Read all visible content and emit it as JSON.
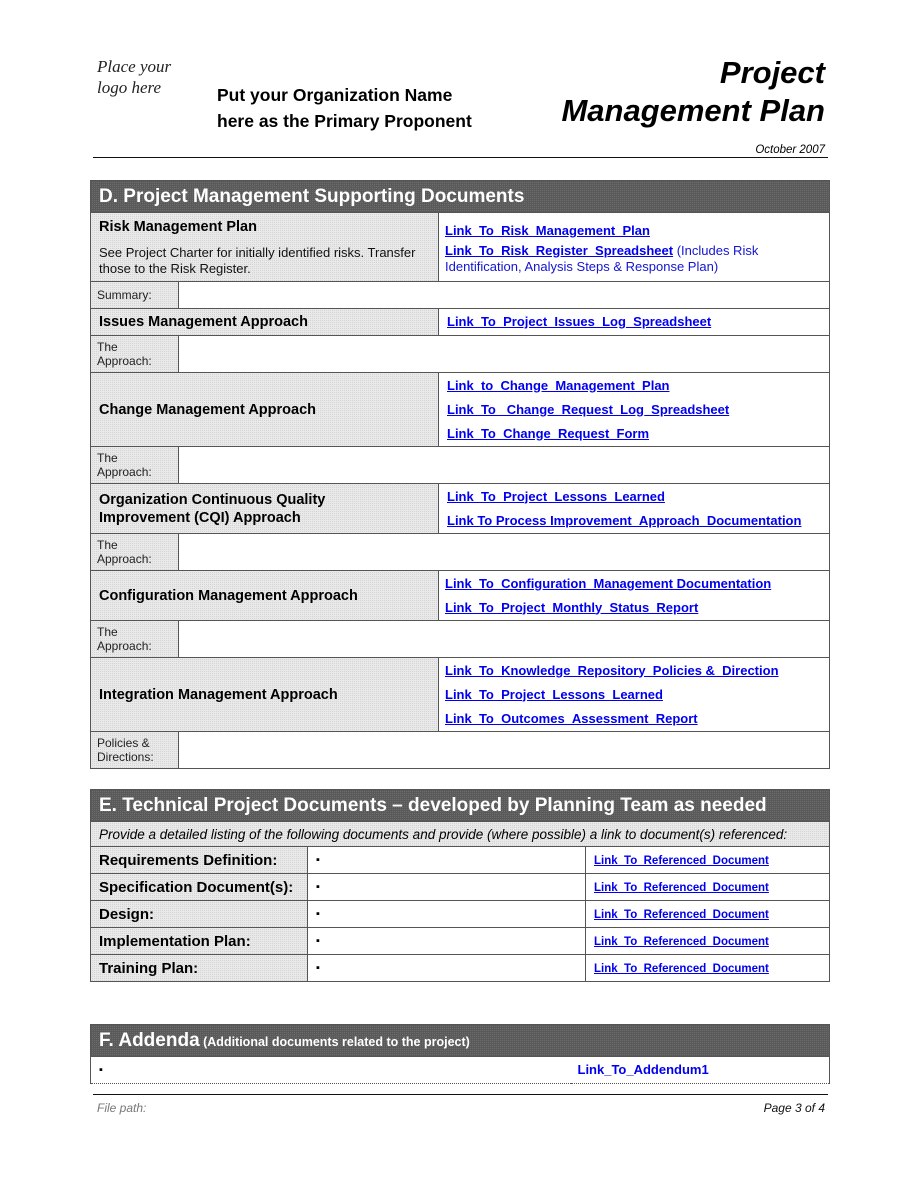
{
  "header": {
    "logo_line1": "Place your",
    "logo_line2": "logo here",
    "org_line1": "Put your Organization Name",
    "org_line2": "here as the Primary Proponent",
    "title_line1": "Project",
    "title_line2": "Management Plan",
    "date": "October 2007"
  },
  "section_d": {
    "title": "D.  Project Management Supporting Documents",
    "risk": {
      "label": "Risk Management Plan",
      "desc": "See Project Charter for initially identified risks. Transfer those to the Risk Register.",
      "link1": "Link_To_Risk_Management_Plan",
      "link2": "Link_To_Risk_Register_Spreadsheet",
      "link2_note": " (Includes Risk Identification, Analysis Steps & Response Plan)",
      "summary_label": "Summary:"
    },
    "issues": {
      "label": "Issues Management Approach",
      "link1": "Link_To_Project_Issues_Log_Spreadsheet",
      "approach_label": "The Approach:"
    },
    "change": {
      "label": "Change Management Approach",
      "link1": "Link_to_Change_Management_Plan",
      "link2": "Link_To_ Change_Request_Log_Spreadsheet",
      "link3": "Link_To_Change_Request_Form",
      "approach_label": "The Approach:"
    },
    "cqi": {
      "label": "Organization Continuous Quality Improvement (CQI) Approach",
      "link1": "Link_To_Project_Lessons_Learned",
      "link2": "Link To Process Improvement_Approach_Documentation",
      "approach_label": "The Approach:"
    },
    "config": {
      "label": "Configuration Management Approach",
      "link1": "Link_To_Configuration_Management Documentation",
      "link2": "Link_To_Project_Monthly_Status_Report",
      "approach_label": "The Approach:"
    },
    "integration": {
      "label": "Integration Management Approach",
      "link1": "Link_To_Knowledge_Repository_Policies &_Direction",
      "link2": "Link_To_Project_Lessons_Learned",
      "link3": "Link_To_Outcomes_Assessment_Report",
      "policies_label": "Policies & Directions:"
    }
  },
  "section_e": {
    "title": "E.  Technical Project Documents – developed by Planning Team as needed",
    "instruction": "Provide a detailed listing of the following documents and provide (where possible) a link to document(s) referenced:",
    "rows": [
      {
        "label": "Requirements Definition:",
        "bullet": "▪",
        "link": "Link_To_Referenced_Document"
      },
      {
        "label": "Specification Document(s):",
        "bullet": "▪",
        "link": "Link_To_Referenced_Document"
      },
      {
        "label": "Design:",
        "bullet": "▪",
        "link": "Link_To_Referenced_Document"
      },
      {
        "label": "Implementation Plan:",
        "bullet": "▪",
        "link": "Link_To_Referenced_Document"
      },
      {
        "label": "Training Plan:",
        "bullet": "▪",
        "link": "Link_To_Referenced_Document"
      }
    ]
  },
  "section_f": {
    "title": "F. Addenda",
    "subtitle": " (Additional documents related to the project)",
    "bullet": "▪",
    "link": "Link_To_Addendum1"
  },
  "footer": {
    "file_path_label": "File path:",
    "page": "Page 3 of 4"
  }
}
